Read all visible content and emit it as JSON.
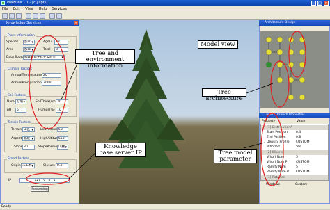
{
  "window": {
    "title": "PoszTree 1.1 - [cl]ll.pts]"
  },
  "menu": [
    "File",
    "Edit",
    "View",
    "Help",
    "Services"
  ],
  "knowledge_panel": {
    "title": "Knowledge Services",
    "plant": {
      "title": "Plant Information",
      "species_label": "Species",
      "species_value": "加拿",
      "agelife_label": "AgeLi",
      "agelife_value": "23",
      "area_label": "Area",
      "area_value": "加拿",
      "total_label": "Total",
      "total_value": "8",
      "datasource_label": "Data Source",
      "datasource_value": "福建省数字农业实验室"
    },
    "climate": {
      "title": "Climate Factors",
      "temp_label": "AnnualTemperature",
      "temp_value": "20",
      "precip_label": "AnnualPrecipitation",
      "precip_value": "2000"
    },
    "soil": {
      "title": "Soil Factors",
      "name_label": "Name",
      "name_value": "红壤",
      "thick_label": "SoilThick(cm)",
      "thick_value": "30",
      "ph_label": "pH",
      "ph_value": "5",
      "humus_label": "Humus(%)",
      "humus_value": "10"
    },
    "terrain": {
      "title": "Terrain Factors",
      "terrain_label": "Terrain",
      "terrain_value": "山区",
      "low_label": "LowAltitude",
      "low_value": "50",
      "aspect_label": "Aspect",
      "aspect_value": "北坡",
      "high_label": "HighAltitude",
      "high_value": "550",
      "slope_label": "Slope",
      "slope_value": "30",
      "slopepos_label": "SlopePosition",
      "slopepos_value": "山腰"
    },
    "stand": {
      "title": "Stand Factors",
      "origin_label": "Origin",
      "origin_value": "人工林",
      "closure_label": "Closure",
      "closure_value": "0.4"
    },
    "ip_label": "IP",
    "ip_value": "127 . 0 . 0 . 1",
    "reasoning_button": "Reasoning"
  },
  "architecture_panel": {
    "title": "Architecture Design"
  },
  "properties_panel": {
    "title": "Level 1 Branch Properties",
    "col_property": "Property",
    "col_value": "Value",
    "rows": [
      {
        "k": "[1] DistributionA",
        "v": ""
      },
      {
        "k": "Start Position",
        "v": "0.4"
      },
      {
        "k": "End Position",
        "v": "0.8"
      },
      {
        "k": "Density Profile",
        "v": "CUSTOM"
      },
      {
        "k": "Whorled",
        "v": "Yes"
      },
      {
        "k": "[2] Whorle",
        "v": ""
      },
      {
        "k": "Whorl Num",
        "v": "5"
      },
      {
        "k": "Whorl Num P",
        "v": "CUSTOM"
      },
      {
        "k": "Ramify Num",
        "v": "5"
      },
      {
        "k": "Ramify Num P",
        "v": "CUSTOM"
      },
      {
        "k": "[3] Rotation",
        "v": ""
      },
      {
        "k": "Windows",
        "v": "Custom"
      }
    ]
  },
  "status": {
    "text": "Ready"
  },
  "callouts": {
    "tree_env": "Tree and environment information",
    "model_view": "Model view",
    "tree_arch": "Tree architecture",
    "kb_ip": "Knowledge base server IP",
    "tree_param": "Tree model parameter"
  },
  "colors": {
    "annotation_red": "#e02020",
    "title_blue": "#1448b8",
    "tree_green": "#2f4f23"
  }
}
